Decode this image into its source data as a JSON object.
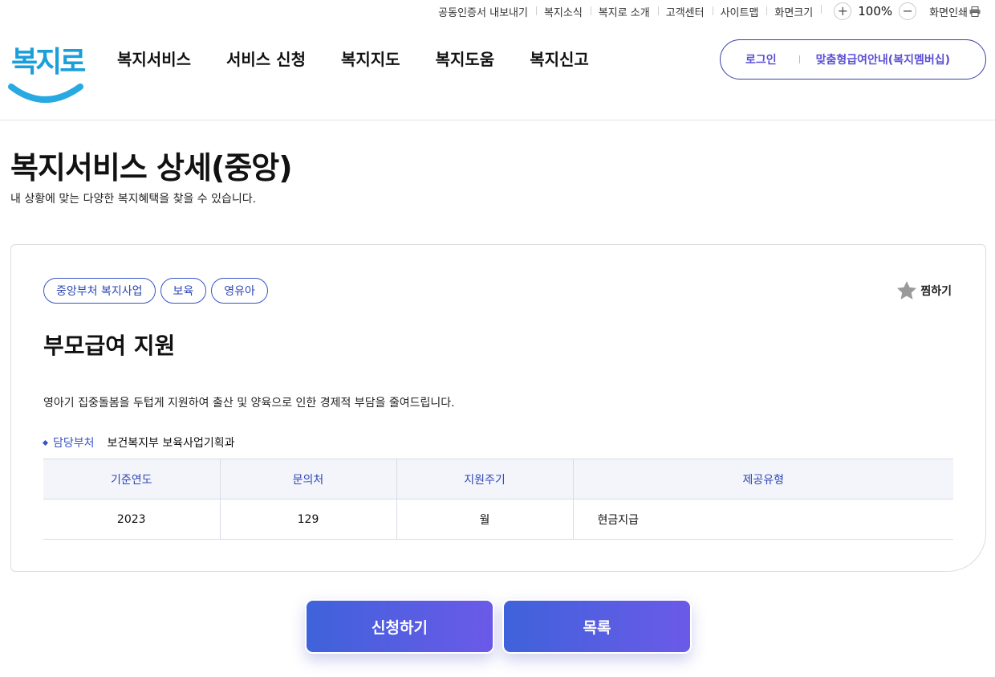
{
  "utility": {
    "links": [
      "공동인증서 내보내기",
      "복지소식",
      "복지로 소개",
      "고객센터",
      "사이트맵",
      "화면크기"
    ],
    "zoom_in": "+",
    "zoom_value": "100%",
    "zoom_out": "−",
    "print": "화면인쇄"
  },
  "header": {
    "logo": "복지로",
    "nav": [
      "복지서비스",
      "서비스 신청",
      "복지지도",
      "복지도움",
      "복지신고"
    ],
    "login": "로그인",
    "member": "맞춤형급여안내(복지멤버십)"
  },
  "page": {
    "title": "복지서비스 상세(중앙)",
    "description": "내 상황에 맞는 다양한 복지혜택을 찾을 수 있습니다."
  },
  "service": {
    "tags": [
      "중앙부처 복지사업",
      "보육",
      "영유아"
    ],
    "favorite": "찜하기",
    "title": "부모급여 지원",
    "description": "영아기 집중돌봄을 두텁게 지원하여 출산 및 양육으로 인한 경제적 부담을 줄여드립니다.",
    "dept_label": "담당부처",
    "dept_value": "보건복지부 보육사업기획과",
    "table": {
      "headers": [
        "기준연도",
        "문의처",
        "지원주기",
        "제공유형"
      ],
      "row": [
        "2023",
        "129",
        "월",
        "현금지급"
      ]
    }
  },
  "actions": {
    "apply": "신청하기",
    "list": "목록"
  },
  "colors": {
    "accent": "#3a53c5",
    "logo": "#1a9fd9",
    "button_start": "#3f62da",
    "button_end": "#6b5ae8"
  }
}
